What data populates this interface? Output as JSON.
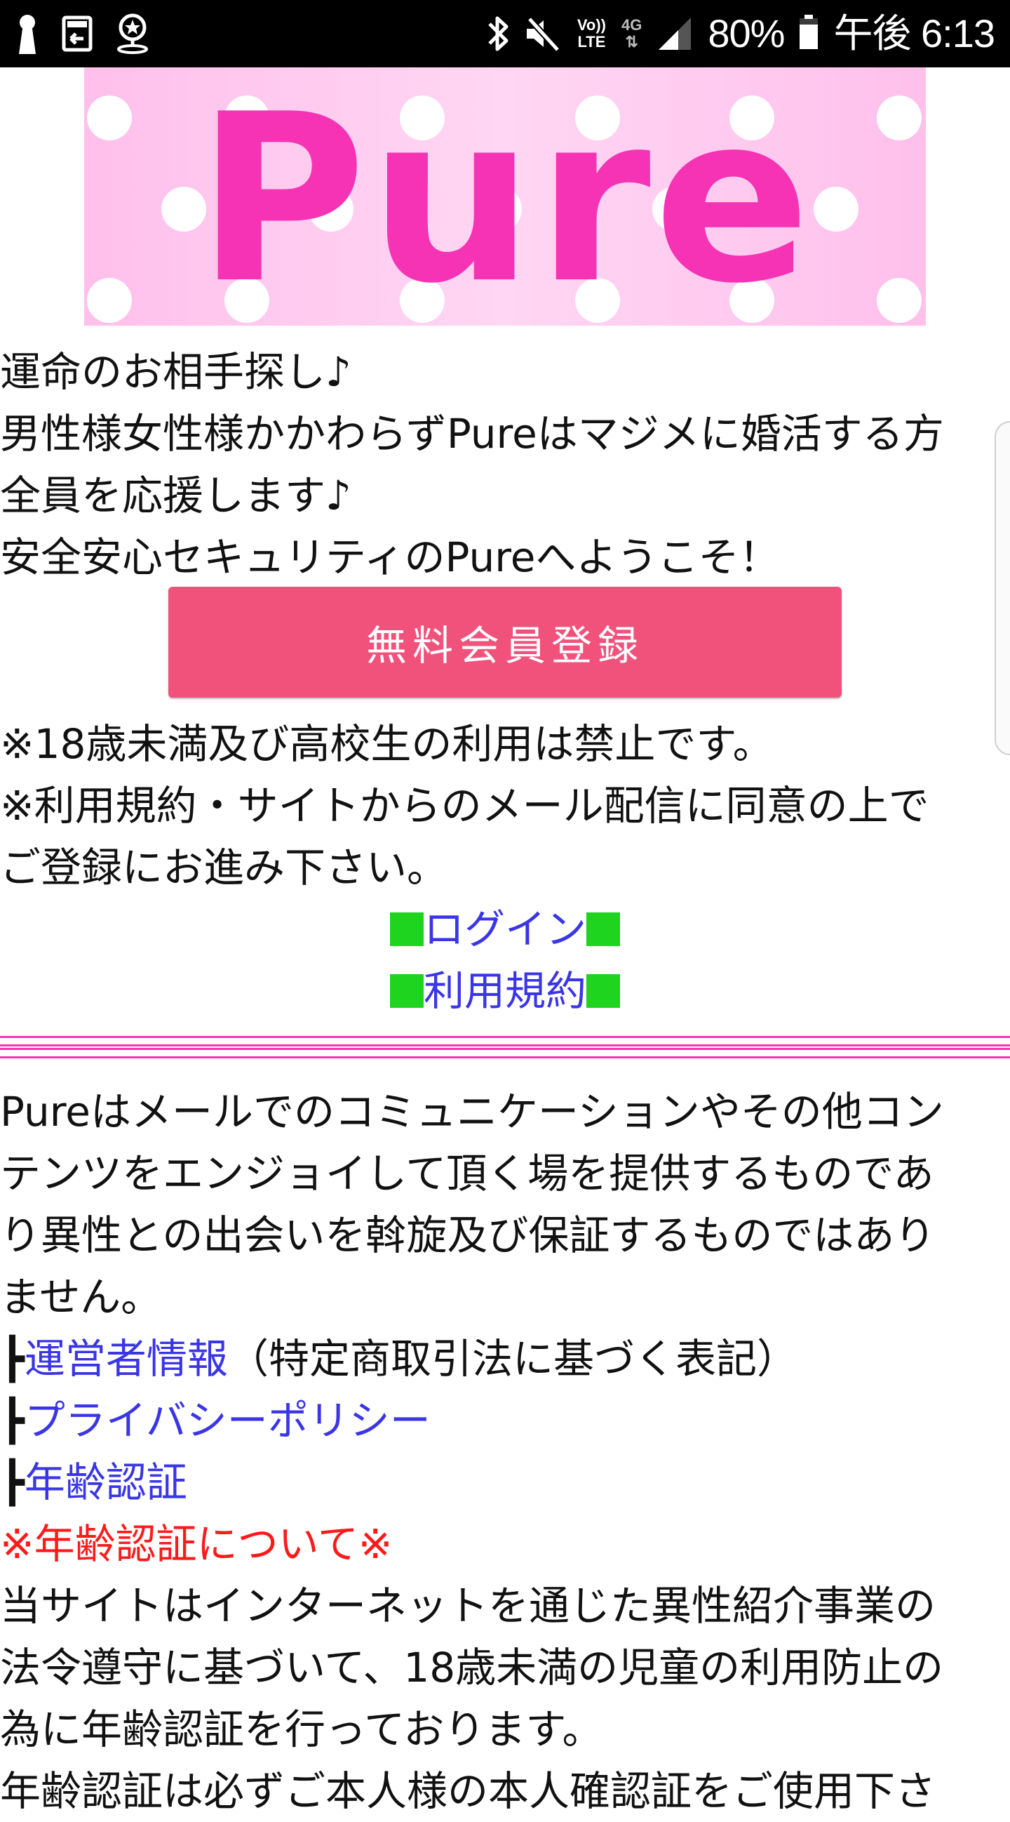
{
  "status_bar": {
    "left_icons": [
      "keyhole-icon",
      "download-box-icon",
      "location-star-icon"
    ],
    "right_icons": [
      "bluetooth-icon",
      "mute-icon",
      "volte-icon",
      "4g-icon",
      "signal-icon",
      "battery-icon"
    ],
    "volte_top": "Vo))",
    "volte_bottom": "LTE",
    "net_type": "4G",
    "battery_percent": "80%",
    "battery_level": 0.8,
    "time": "午後 6:13"
  },
  "banner": {
    "logo_text": "Pure",
    "colors": {
      "logo": "#f533b4",
      "background": "#ffc8ee",
      "dots": "#ffffff"
    }
  },
  "intro": {
    "line1": "運命のお相手探し♪",
    "line2": "男性様女性様かかわらずPureはマジメに婚活する方",
    "line3": "全員を応援します♪",
    "line4": "安全安心セキュリティのPureへようこそ！"
  },
  "register_button": {
    "label": "無料会員登録",
    "color": "#f0527c"
  },
  "notices": {
    "line1": "※18歳未満及び高校生の利用は禁止です。",
    "line2": "※利用規約・サイトからのメール配信に同意の上で",
    "line3": "ご登録にお進み下さい。"
  },
  "nav_links": {
    "login": "ログイン",
    "terms": "利用規約",
    "marker_color": "#1ed41e"
  },
  "about": {
    "line1": "Pureはメールでのコミュニケーションやその他コン",
    "line2": "テンツをエンジョイして頂く場を提供するものであ",
    "line3": "り異性との出会いを斡旋及び保証するものではあり",
    "line4": "ません。"
  },
  "info_links": {
    "branch": "┣",
    "operator": "運営者情報",
    "operator_note": "（特定商取引法に基づく表記）",
    "privacy": "プライバシーポリシー",
    "age_verification": "年齢認証"
  },
  "age_section": {
    "heading": "※年齢認証について※",
    "line1": "当サイトはインターネットを通じた異性紹介事業の",
    "line2": "法令遵守に基づいて、18歳未満の児童の利用防止の",
    "line3": "為に年齢認証を行っております。",
    "line4": "年齢認証は必ずご本人様の本人確認証をご使用下さ"
  }
}
